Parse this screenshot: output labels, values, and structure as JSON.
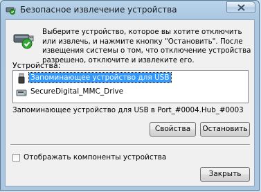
{
  "window": {
    "title": "Безопасное извлечение устройства"
  },
  "instructions": "Выберите устройство, которое вы хотите отключить или извлечь, и нажмите кнопку \"Остановить\". После извещения системы о том, что отключение устройства разрешено, отключите и извлеките его.",
  "devices_label": "Устройства:",
  "devices": [
    {
      "label": "Запоминающее устройство для USB",
      "icon": "usb-drive-icon",
      "selected": true
    },
    {
      "label": "SecureDigital_MMC_Drive",
      "icon": "card-reader-icon",
      "selected": false
    }
  ],
  "device_description": "Запоминающее устройство для USB в Port_#0004.Hub_#0003",
  "buttons": {
    "properties": "Свойства",
    "stop": "Остановить",
    "close": "Закрыть"
  },
  "show_components": {
    "label": "Отображать компоненты устройства",
    "checked": false
  },
  "colors": {
    "selection": "#3399ff",
    "window_frame": "#aac6e0",
    "client": "#f0f0f0"
  }
}
